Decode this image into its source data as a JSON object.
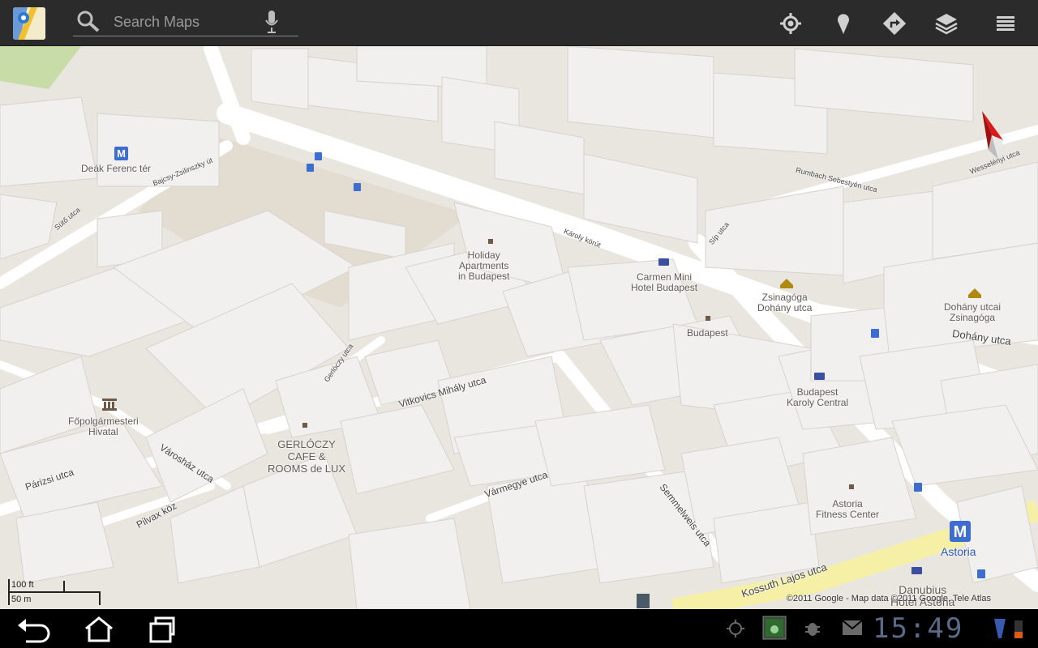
{
  "search": {
    "placeholder": "Search Maps",
    "value": ""
  },
  "toolbar": {
    "icons": [
      "my-location-icon",
      "places-icon",
      "directions-icon",
      "layers-icon",
      "menu-icon"
    ]
  },
  "map": {
    "places": {
      "deak": "Deák Ferenc tér",
      "holiday": [
        "Holiday",
        "Apartments",
        "in Budapest"
      ],
      "carmen": [
        "Carmen Mini",
        "Hotel Budapest"
      ],
      "zsinagoga": [
        "Zsinagóga",
        "Dohány utca"
      ],
      "dohany_zs": [
        "Dohány utcai",
        "Zsinagóga"
      ],
      "budapest": "Budapest",
      "karoly_central": [
        "Budapest",
        "Karoly Central"
      ],
      "fopolg": [
        "Főpolgármesteri",
        "Hivatal"
      ],
      "gerloczy": [
        "GERLÓCZY",
        "CAFE &",
        "ROOMS de LUX"
      ],
      "astoria_fit": [
        "Astoria",
        "Fitness Center"
      ],
      "astoria": "Astoria",
      "danubius": [
        "Danubius",
        "Hotel Astoria"
      ]
    },
    "streets": {
      "bajcsy": "Bajcsy-Zsilinszky út",
      "suto": "Sütő utca",
      "karoly": "Károly körút",
      "rumbach": "Rumbach Sebestyén utca",
      "wesselenyi": "Wesselényi utca",
      "dohany": "Dohány utca",
      "sip": "Síp utca",
      "gerloczy_u": "Gerlóczy utca",
      "vitkovics": "Vitkovics Mihály utca",
      "varoshaz": "Városház utca",
      "parizsi": "Párizsi utca",
      "pilvax": "Pilvax köz",
      "varmegye": "Vármegye utca",
      "semmelweis": "Semmelweis utca",
      "kossuth": "Kossuth Lajos utca"
    },
    "scale": {
      "imperial": "100 ft",
      "metric": "50 m"
    },
    "copyright": "©2011 Google - Map data ©2011 Google, Tele Atlas"
  },
  "system": {
    "clock": "15:49",
    "nav": [
      "back-icon",
      "home-icon",
      "recent-apps-icon"
    ],
    "status": [
      "gps-icon",
      "gallery-icon",
      "usb-debug-icon",
      "gmail-icon",
      "wifi-icon",
      "battery-icon"
    ]
  },
  "colors": {
    "topbar": "#2b2b2b",
    "map_bg": "#e9e6e0",
    "major_road": "#f5f0a6",
    "building": "#f1f0ee",
    "clock": "#5b6a86"
  }
}
